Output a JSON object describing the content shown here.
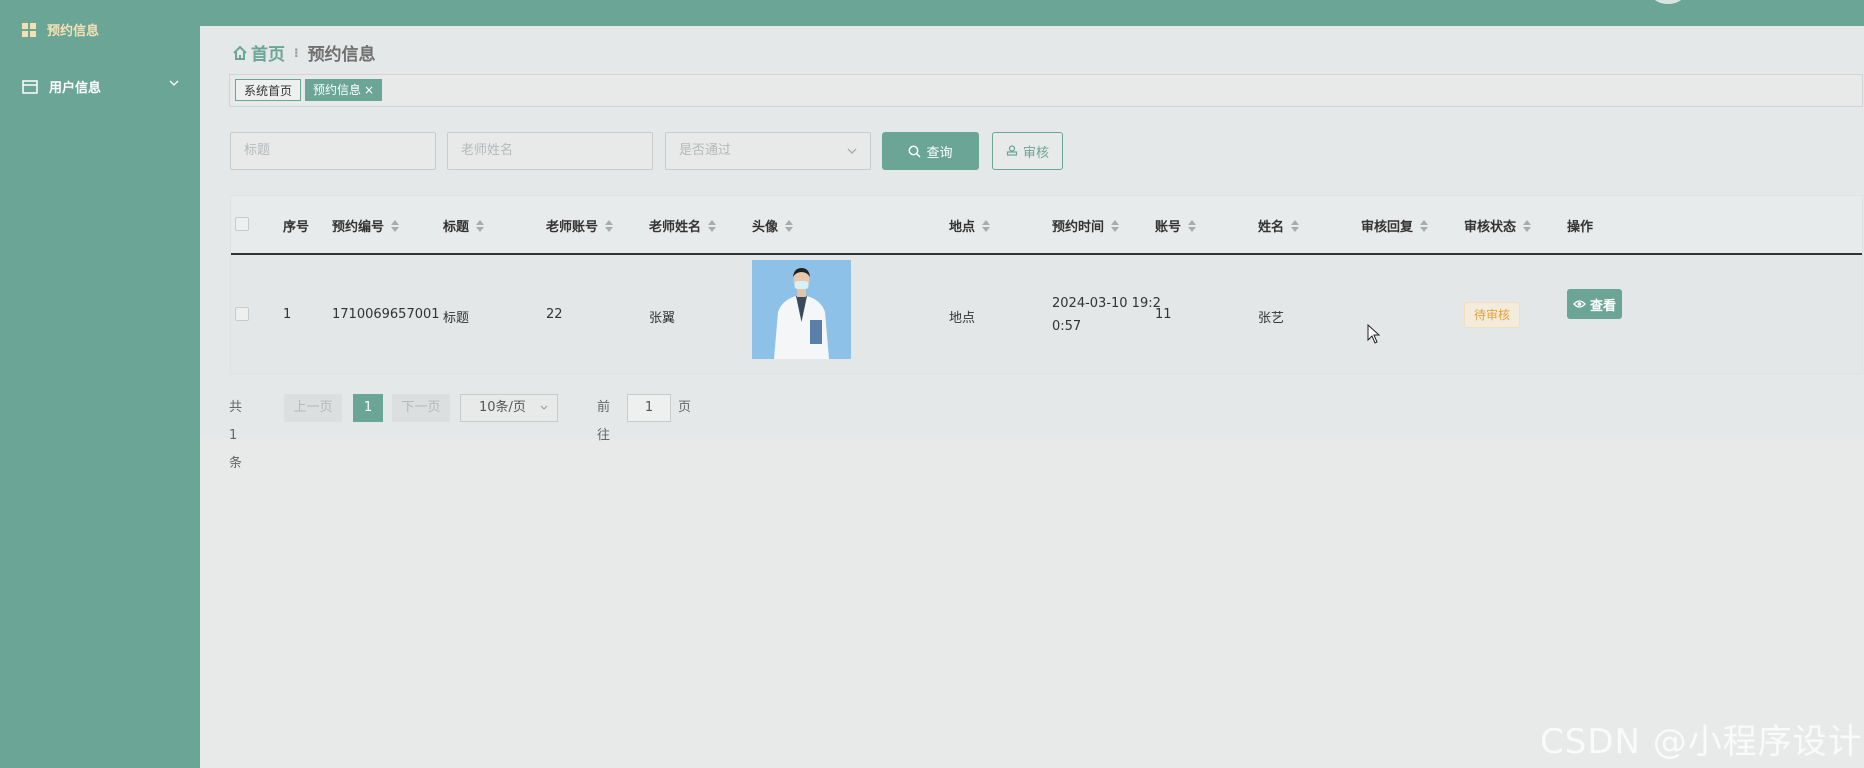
{
  "sidebar": {
    "items": [
      {
        "label": "预约信息",
        "icon": "grid-icon",
        "active": true
      },
      {
        "label": "用户信息",
        "icon": "window-icon",
        "active": false
      }
    ]
  },
  "breadcrumb": {
    "home": "首页",
    "current": "预约信息"
  },
  "tabs": [
    {
      "label": "系统首页"
    },
    {
      "label": "预约信息",
      "close": "×"
    }
  ],
  "search": {
    "title_placeholder": "标题",
    "teacher_placeholder": "老师姓名",
    "pass_placeholder": "是否通过",
    "query_label": "查询",
    "audit_label": "审核"
  },
  "table": {
    "headers": [
      "序号",
      "预约编号",
      "标题",
      "老师账号",
      "老师姓名",
      "头像",
      "地点",
      "预约时间",
      "账号",
      "姓名",
      "审核回复",
      "审核状态",
      "操作"
    ],
    "rows": [
      {
        "index": "1",
        "booking_no": "1710069657001",
        "title": "标题",
        "teacher_account": "22",
        "teacher_name": "张翼",
        "location": "地点",
        "time_line1": "2024-03-10 19:2",
        "time_line2": "0:57",
        "account": "11",
        "name": "张艺",
        "reply": "",
        "status": "待审核",
        "action": "查看"
      }
    ]
  },
  "pagination": {
    "total": "共 1 条",
    "prev": "上一页",
    "current_page": "1",
    "next": "下一页",
    "page_size": "10条/页",
    "goto_label": "前往",
    "goto_value": "1",
    "page_unit": "页"
  },
  "watermark": "CSDN @小程序设计",
  "colors": {
    "accent": "#6aa595",
    "warning": "#e6a23c",
    "active_menu": "#f3e1b4"
  }
}
